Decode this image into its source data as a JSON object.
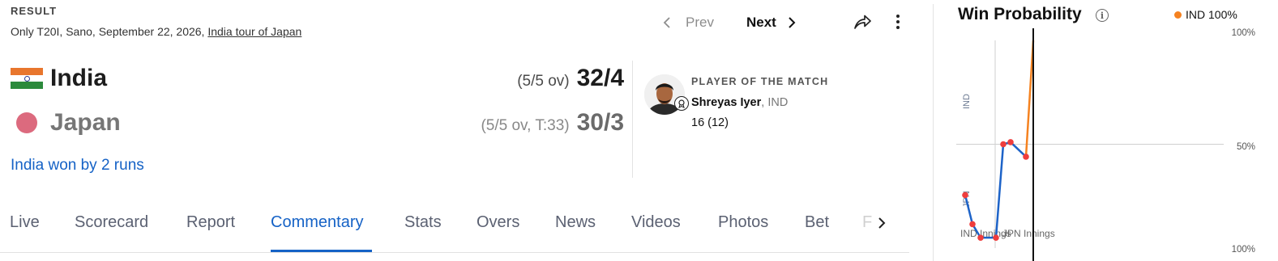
{
  "header": {
    "result_label": "RESULT",
    "match_info": "Only T20I, Sano, September 22, 2026, ",
    "tour_link": "India tour of Japan",
    "prev_label": "Prev",
    "next_label": "Next"
  },
  "teams": [
    {
      "name": "India",
      "overs": "(5/5 ov)",
      "score": "32/4"
    },
    {
      "name": "Japan",
      "overs": "(5/5 ov, T:33)",
      "score": "30/3"
    }
  ],
  "result_text": "India won by 2 runs",
  "player_of_match": {
    "title": "PLAYER OF THE MATCH",
    "name": "Shreyas Iyer",
    "team": ", IND",
    "stat": "16 (12)"
  },
  "tabs": [
    {
      "label": "Live",
      "active": false
    },
    {
      "label": "Scorecard",
      "active": false
    },
    {
      "label": "Report",
      "active": false
    },
    {
      "label": "Commentary",
      "active": true
    },
    {
      "label": "Stats",
      "active": false
    },
    {
      "label": "Overs",
      "active": false
    },
    {
      "label": "News",
      "active": false
    },
    {
      "label": "Videos",
      "active": false
    },
    {
      "label": "Photos",
      "active": false
    },
    {
      "label": "Bet",
      "active": false
    },
    {
      "label": "F",
      "active": false
    }
  ],
  "win_probability": {
    "title": "Win Probability",
    "legend": "IND 100%",
    "y_labels": [
      "100%",
      "50%",
      "100%"
    ],
    "side_labels": [
      "IND",
      "JPN"
    ],
    "innings_labels": [
      "IND Innings",
      "JPN Innings"
    ],
    "colors": {
      "blue": "#1d63c8",
      "orange": "#f58220",
      "point": "#ef3d3d"
    }
  },
  "chart_data": {
    "type": "line",
    "title": "Win Probability",
    "xlabel": "",
    "ylabel": "",
    "ylim": [
      -100,
      100
    ],
    "y_axis_meaning": "positive = IND win %, negative = JPN win %",
    "series": [
      {
        "name": "IND Innings",
        "x": [
          0,
          1,
          2,
          3,
          4,
          5,
          6,
          7
        ],
        "y": [
          -49,
          -77,
          -90,
          -90,
          0,
          2,
          -12,
          100
        ]
      }
    ],
    "points": [
      0,
      1,
      2,
      3,
      4,
      5,
      6
    ]
  }
}
